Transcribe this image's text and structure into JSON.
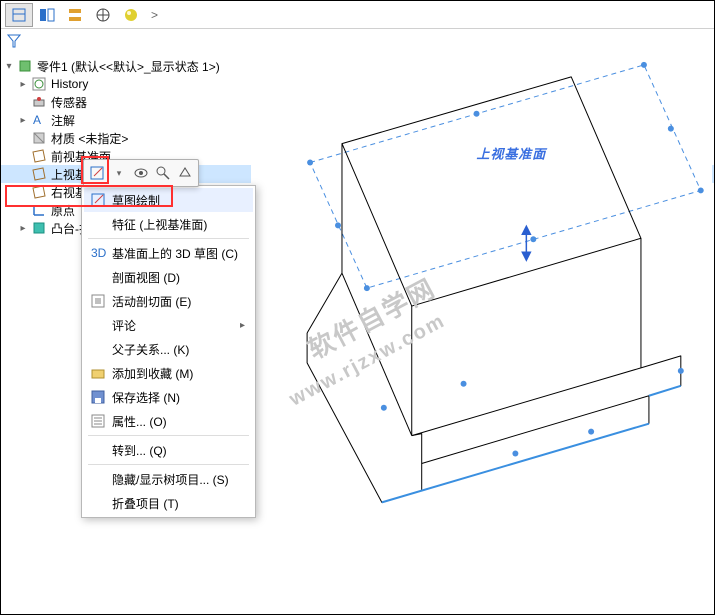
{
  "tabs": {
    "more": ">"
  },
  "root": {
    "label": "零件1 (默认<<默认>_显示状态 1>)"
  },
  "nodes": {
    "history": "History",
    "sensors": "传感器",
    "annot": "注解",
    "material": "材质 <未指定>",
    "front": "前视基准面",
    "top": "上视基准面",
    "right": "右视基准面",
    "origin": "原点",
    "boss": "凸台-拉伸1"
  },
  "ctx": {
    "top": "草图绘制",
    "feature": "特征 (上视基准面)",
    "sketch3d": "基准面上的 3D 草图 (C)",
    "section": "剖面视图 (D)",
    "livesec": "活动剖切面 (E)",
    "comment": "评论",
    "parent": "父子关系... (K)",
    "addfav": "添加到收藏 (M)",
    "savesel": "保存选择 (N)",
    "props": "属性... (O)",
    "goto": "转到... (Q)",
    "hideshow": "隐藏/显示树项目... (S)",
    "collapse": "折叠项目 (T)"
  },
  "viewport": {
    "plane_label": "上视基准面",
    "watermark1": "软件自学网",
    "watermark2": "www.rjzxw.com"
  }
}
